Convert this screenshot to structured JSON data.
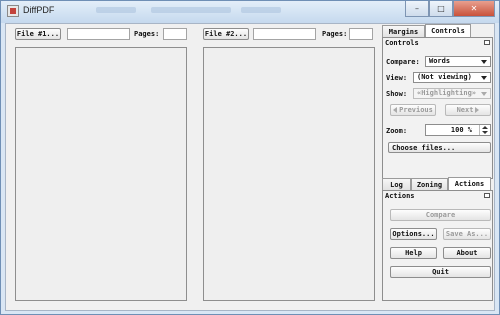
{
  "window": {
    "title": "DiffPDF",
    "minimize_glyph": "–",
    "maximize_glyph": "□",
    "close_glyph": "✕"
  },
  "left_pane": {
    "file_button_label": "File #1...",
    "file_value": "",
    "pages_label": "Pages:",
    "pages_value": ""
  },
  "right_pane": {
    "file_button_label": "File #2...",
    "file_value": "",
    "pages_label": "Pages:",
    "pages_value": ""
  },
  "top_tabs": [
    {
      "label": "Margins",
      "active": false
    },
    {
      "label": "Controls",
      "active": true
    }
  ],
  "controls": {
    "section_title": "Controls",
    "compare_label": "Compare:",
    "compare_value": "Words",
    "view_label": "View:",
    "view_value": "(Not viewing)",
    "show_label": "Show:",
    "show_value": "«Highlighting»",
    "previous_label": "Previous",
    "next_label": "Next",
    "zoom_label": "Zoom:",
    "zoom_value": "100 %",
    "choose_files_label": "Choose files..."
  },
  "bottom_tabs": [
    {
      "label": "Log",
      "active": false
    },
    {
      "label": "Zoning",
      "active": false
    },
    {
      "label": "Actions",
      "active": true
    }
  ],
  "actions": {
    "section_title": "Actions",
    "compare_label": "Compare",
    "options_label": "Options...",
    "save_as_label": "Save As...",
    "help_label": "Help",
    "about_label": "About",
    "quit_label": "Quit"
  },
  "icons": {
    "app": "diffpdf-app-icon",
    "float": "float-dock-icon"
  }
}
